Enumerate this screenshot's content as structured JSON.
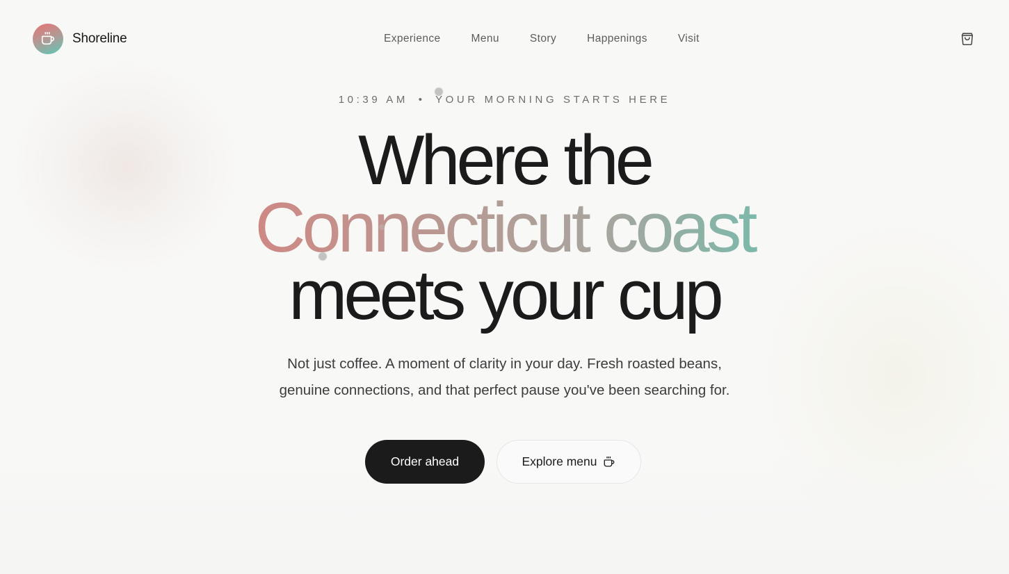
{
  "brand": {
    "name": "Shoreline",
    "logo_icon": "coffee-cup-icon"
  },
  "nav": {
    "items": [
      {
        "label": "Experience"
      },
      {
        "label": "Menu"
      },
      {
        "label": "Story"
      },
      {
        "label": "Happenings"
      },
      {
        "label": "Visit"
      }
    ],
    "cart_icon": "shopping-bag-icon"
  },
  "hero": {
    "time": "10:39 AM",
    "separator": "•",
    "tagline": "YOUR MORNING STARTS HERE",
    "headline_line1": "Where the",
    "headline_line2": "Connecticut coast",
    "headline_line3": "meets your cup",
    "subhead_line1": "Not just coffee. A moment of clarity in your day. Fresh roasted beans,",
    "subhead_line2": "genuine connections, and that perfect pause you've been searching for.",
    "primary_cta": "Order ahead",
    "secondary_cta": "Explore menu",
    "secondary_cta_icon": "coffee-cup-icon"
  },
  "colors": {
    "accent_start": "#e86d6d",
    "accent_end": "#56c9ba",
    "primary_button": "#1b1b1b",
    "background": "#f8f8f7"
  }
}
